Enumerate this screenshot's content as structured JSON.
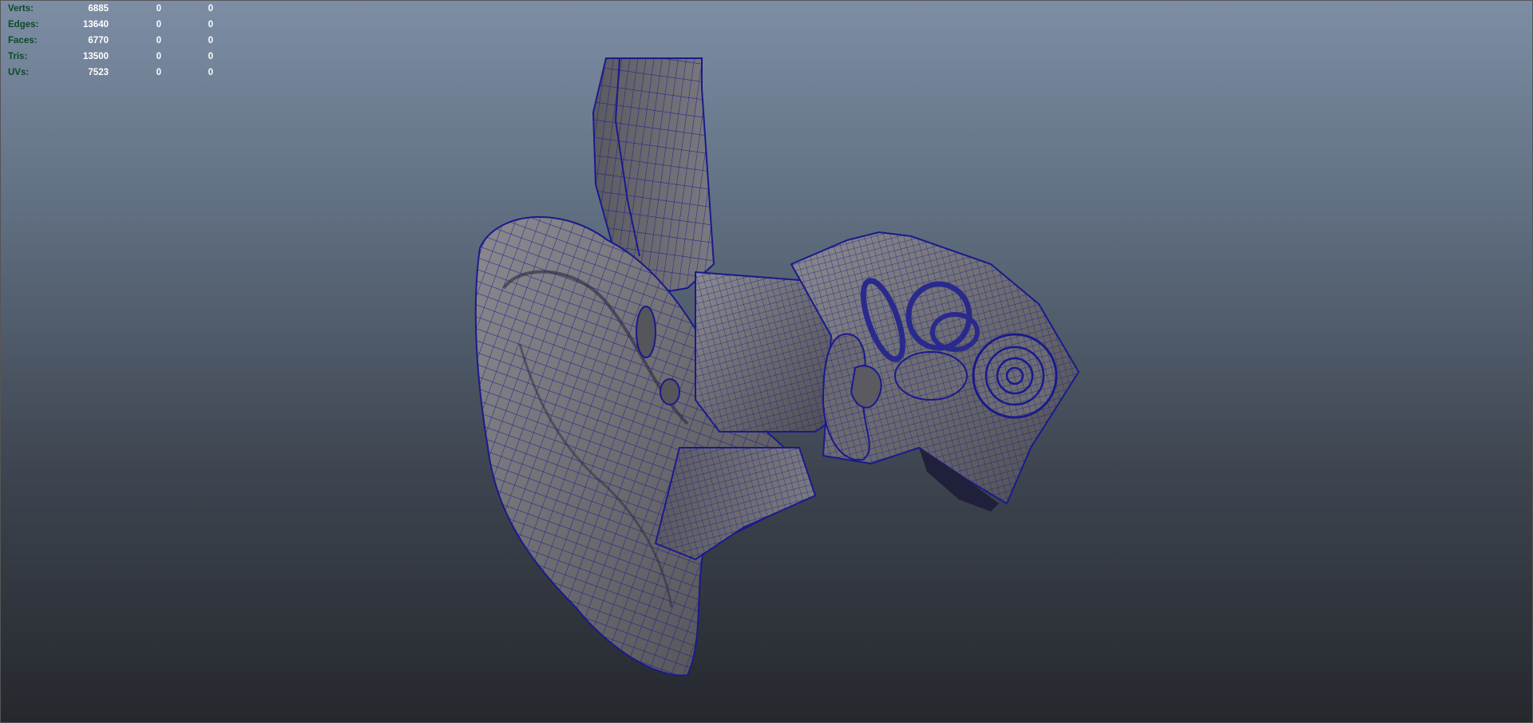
{
  "viewport": {
    "background_top": "#7d8da4",
    "background_bottom": "#25282d",
    "wire_color": "#1a1a8c",
    "shade_color": "#6b6b70",
    "model_icon": "ear-mesh-icon"
  },
  "hud": {
    "rows": [
      {
        "label": "Verts:",
        "total": "6885",
        "selected": "0",
        "components": "0"
      },
      {
        "label": "Edges:",
        "total": "13640",
        "selected": "0",
        "components": "0"
      },
      {
        "label": "Faces:",
        "total": "6770",
        "selected": "0",
        "components": "0"
      },
      {
        "label": "Tris:",
        "total": "13500",
        "selected": "0",
        "components": "0"
      },
      {
        "label": "UVs:",
        "total": "7523",
        "selected": "0",
        "components": "0"
      }
    ]
  }
}
